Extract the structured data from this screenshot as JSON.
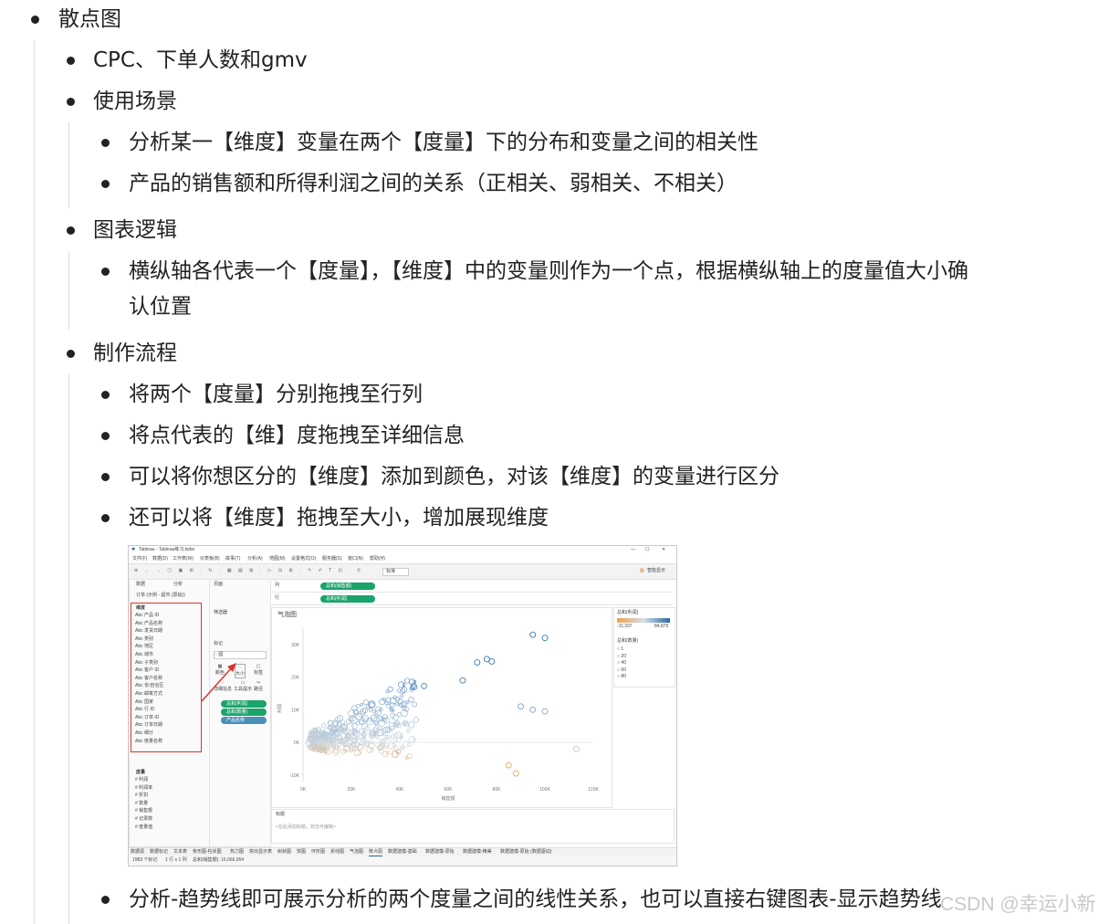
{
  "outline": {
    "l0": "散点图",
    "items": [
      "CPC、下单人数和gmv",
      "使用场景",
      "分析某一【维度】变量在两个【度量】下的分布和变量之间的相关性",
      "产品的销售额和所得利润之间的关系（正相关、弱相关、不相关）",
      "图表逻辑",
      "横纵轴各代表一个【度量】，【维度】中的变量则作为一个点，根据横纵轴上的度量值大小确",
      "认位置",
      "制作流程",
      "将两个【度量】分别拖拽至行列",
      "将点代表的【维】度拖拽至详细信息",
      "可以将你想区分的【维度】添加到颜色，对该【维度】的变量进行区分",
      "还可以将【维度】拖拽至大小，增加展现维度",
      "分析-趋势线即可展示分析的两个度量之间的线性关系，也可以直接右键图表-显示趋势线"
    ]
  },
  "screenshot": {
    "window_title": "Tableau - Tableau练习.twbx",
    "menu": [
      "文件(F)",
      "数据(D)",
      "工作表(W)",
      "仪表板(B)",
      "故事(T)",
      "分析(A)",
      "地图(M)",
      "设置格式(O)",
      "服务器(S)",
      "窗口(N)",
      "帮助(H)"
    ],
    "smart_show": "智能显示",
    "data_tab": "数据",
    "analysis_tab": "分析",
    "datasource": "订单 (示例 - 超市 (原始))",
    "dimensions_header": "维度",
    "dimensions": [
      "产品 ID",
      "产品名称",
      "发货日期",
      "类别",
      "地区",
      "城市",
      "子类别",
      "客户 ID",
      "客户名称",
      "省/自治区",
      "邮寄方式",
      "国家",
      "行 ID",
      "订单 ID",
      "订单日期",
      "细分",
      "度量名称"
    ],
    "measures_header": "度量",
    "measures": [
      "利润",
      "利润率",
      "折扣",
      "数量",
      "销售额",
      "记录数",
      "度量值"
    ],
    "pages_label": "页面",
    "filters_label": "筛选器",
    "marks_label": "标记",
    "mark_type": "圆",
    "mark_buttons": [
      "颜色",
      "大小",
      "标签",
      "详细信息",
      "工具提示",
      "路径"
    ],
    "mark_pills": [
      "总和(利润)",
      "总和(数量)",
      "产品名称"
    ],
    "columns_label": "列",
    "rows_label": "行",
    "columns_pill": "总和(销售额)",
    "rows_pill": "总和(利润)",
    "chart_title": "气泡图",
    "color_legend_title": "总和(利润)",
    "color_min": "-11,337",
    "color_max": "84,875",
    "size_legend_title": "总和(数量)",
    "size_values": [
      "1",
      "20",
      "40",
      "60",
      "80"
    ],
    "x_axis_label": "销售额",
    "y_axis_label": "利润",
    "caption_label": "标题",
    "caption_text": "<在此添加标题，双击可编辑>",
    "sheet_tabs": [
      "数据源",
      "数据标记",
      "文本表",
      "条形图-柱状图",
      "热力图",
      "突出显示表",
      "树状图",
      "饼图",
      "环形图",
      "折线图",
      "气泡图",
      "散点图",
      "数据建模-基础",
      "数据建模-原始",
      "数据建模-精美",
      "数据建模-原始 (数据驱动)"
    ],
    "status_left": "1983 个标记",
    "status_mid": "1 行 x 1 列",
    "status_right": "总和(销售额): 16,066,954"
  },
  "chart_data": {
    "type": "scatter",
    "title": "气泡图",
    "xlabel": "销售额",
    "ylabel": "利润",
    "x_ticks": [
      "0K",
      "20K",
      "40K",
      "60K",
      "80K",
      "100K",
      "120K"
    ],
    "y_ticks": [
      "-10K",
      "0K",
      "10K",
      "20K",
      "30K"
    ],
    "xlim": [
      0,
      120000
    ],
    "ylim": [
      -12000,
      35000
    ],
    "palette": {
      "low": "#f0a050",
      "mid": "#c8d4dc",
      "high": "#3a78b8"
    },
    "highlight_points": [
      {
        "x": 95000,
        "y": 33000
      },
      {
        "x": 100000,
        "y": 32000
      },
      {
        "x": 72000,
        "y": 24500
      },
      {
        "x": 76000,
        "y": 25500
      },
      {
        "x": 78000,
        "y": 24800
      },
      {
        "x": 66000,
        "y": 19000
      },
      {
        "x": 46000,
        "y": 17000
      },
      {
        "x": 50000,
        "y": 17300
      },
      {
        "x": 90000,
        "y": 11000
      },
      {
        "x": 95000,
        "y": 10000
      },
      {
        "x": 100000,
        "y": 9500
      },
      {
        "x": 113000,
        "y": -2000
      },
      {
        "x": 85000,
        "y": -7000
      },
      {
        "x": 88000,
        "y": -9500
      }
    ],
    "cluster": {
      "x_center": 12000,
      "y_center": 0,
      "count": 1983
    }
  },
  "watermark": "CSDN @幸运小新"
}
